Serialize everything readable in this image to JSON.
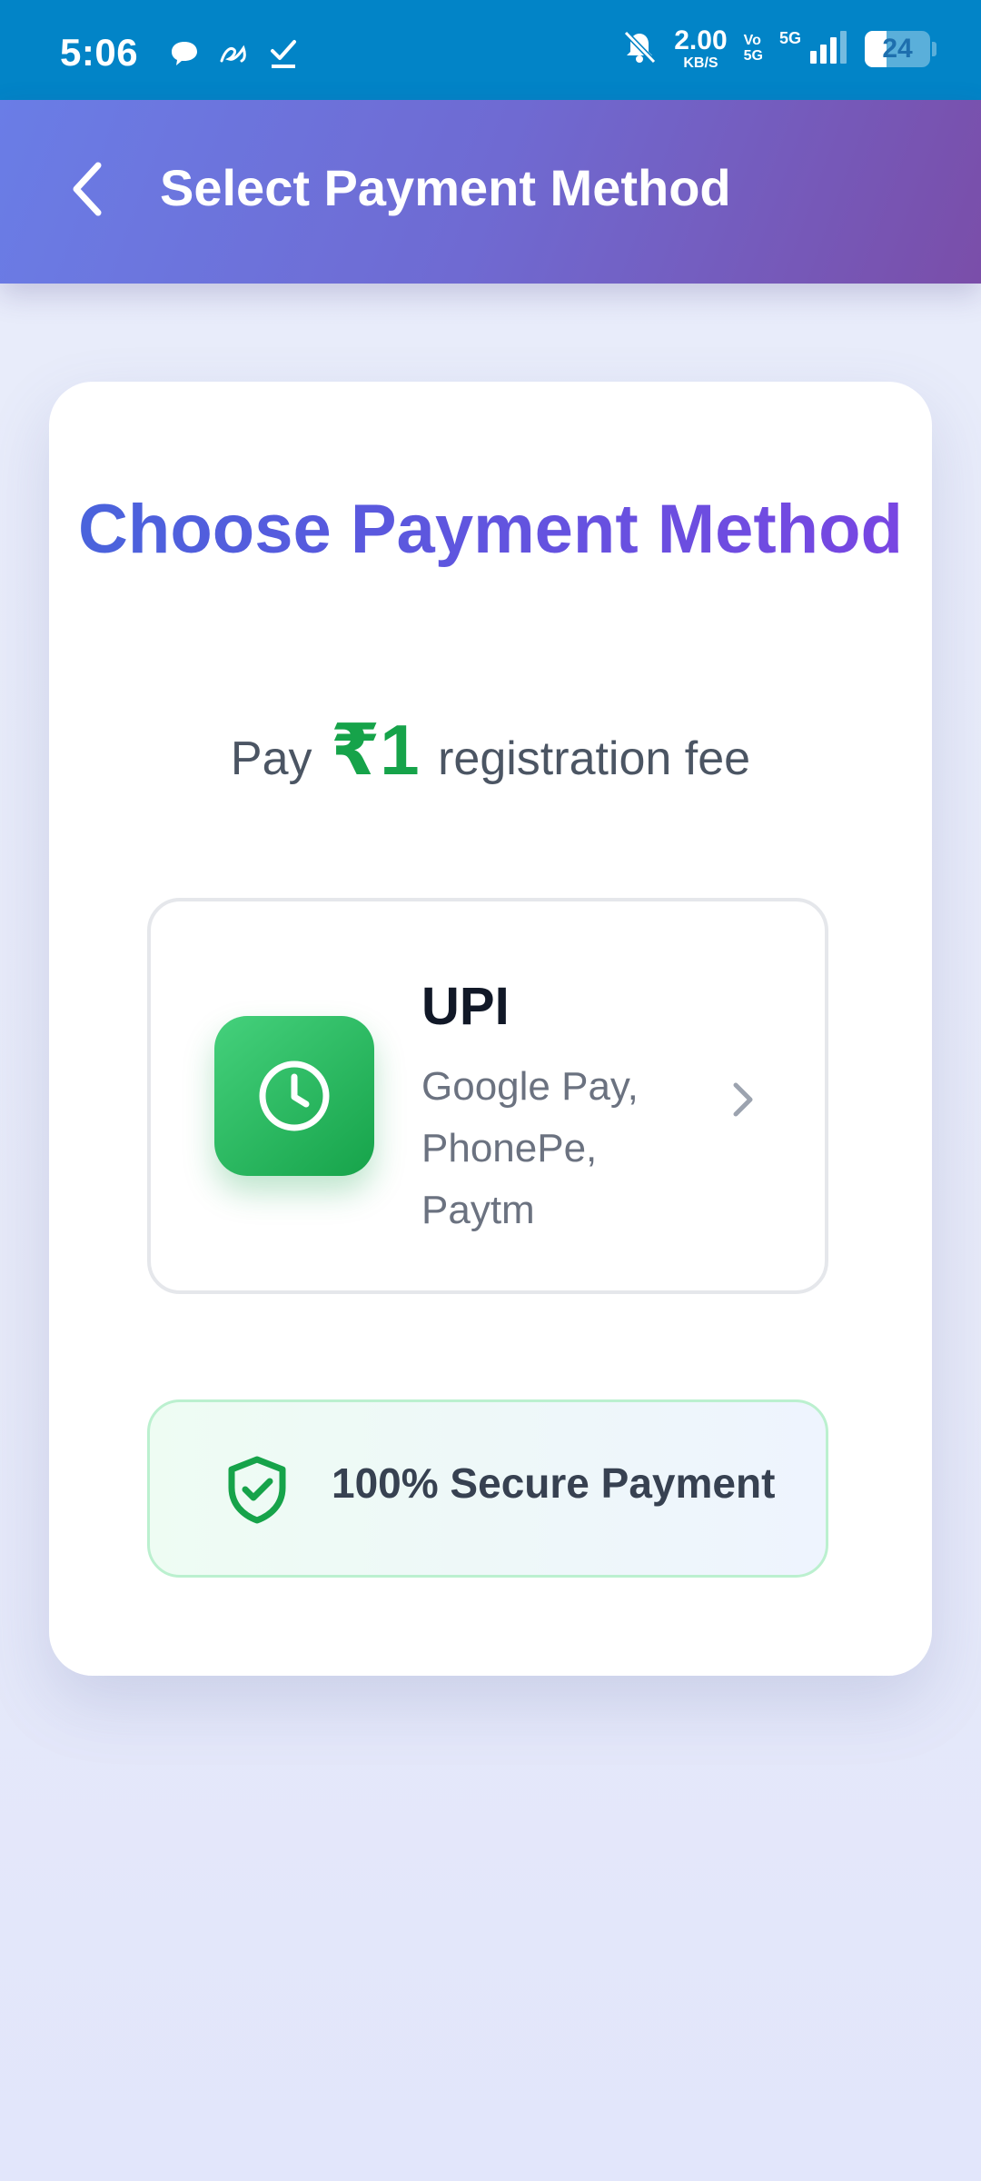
{
  "status_bar": {
    "time": "5:06",
    "net_speed": "2.00",
    "net_unit": "KB/S",
    "volte_top": "Vo",
    "volte_bottom": "5G",
    "network": "5G",
    "battery": "24",
    "icons": [
      "chat-bubble-icon",
      "notification-app-icon",
      "checkmark-icon",
      "bell-off-icon",
      "signal-icon",
      "battery-icon"
    ]
  },
  "header": {
    "title": "Select Payment Method",
    "back_icon": "chevron-left-icon"
  },
  "card": {
    "title": "Choose Payment Method",
    "fee_prefix": "Pay",
    "fee_amount": "₹1",
    "fee_suffix": "registration fee",
    "option": {
      "name": "UPI",
      "description": "Google Pay, PhonePe, Paytm",
      "icon": "clock-icon",
      "chevron": "chevron-right-icon"
    },
    "secure": {
      "text": "100% Secure Payment",
      "icon": "shield-check-icon"
    }
  },
  "colors": {
    "status_bar": "#0284c7",
    "header_start": "#6a7de6",
    "header_end": "#7a4ea9",
    "amount": "#16a34a",
    "upi_green": "#22c55e"
  }
}
